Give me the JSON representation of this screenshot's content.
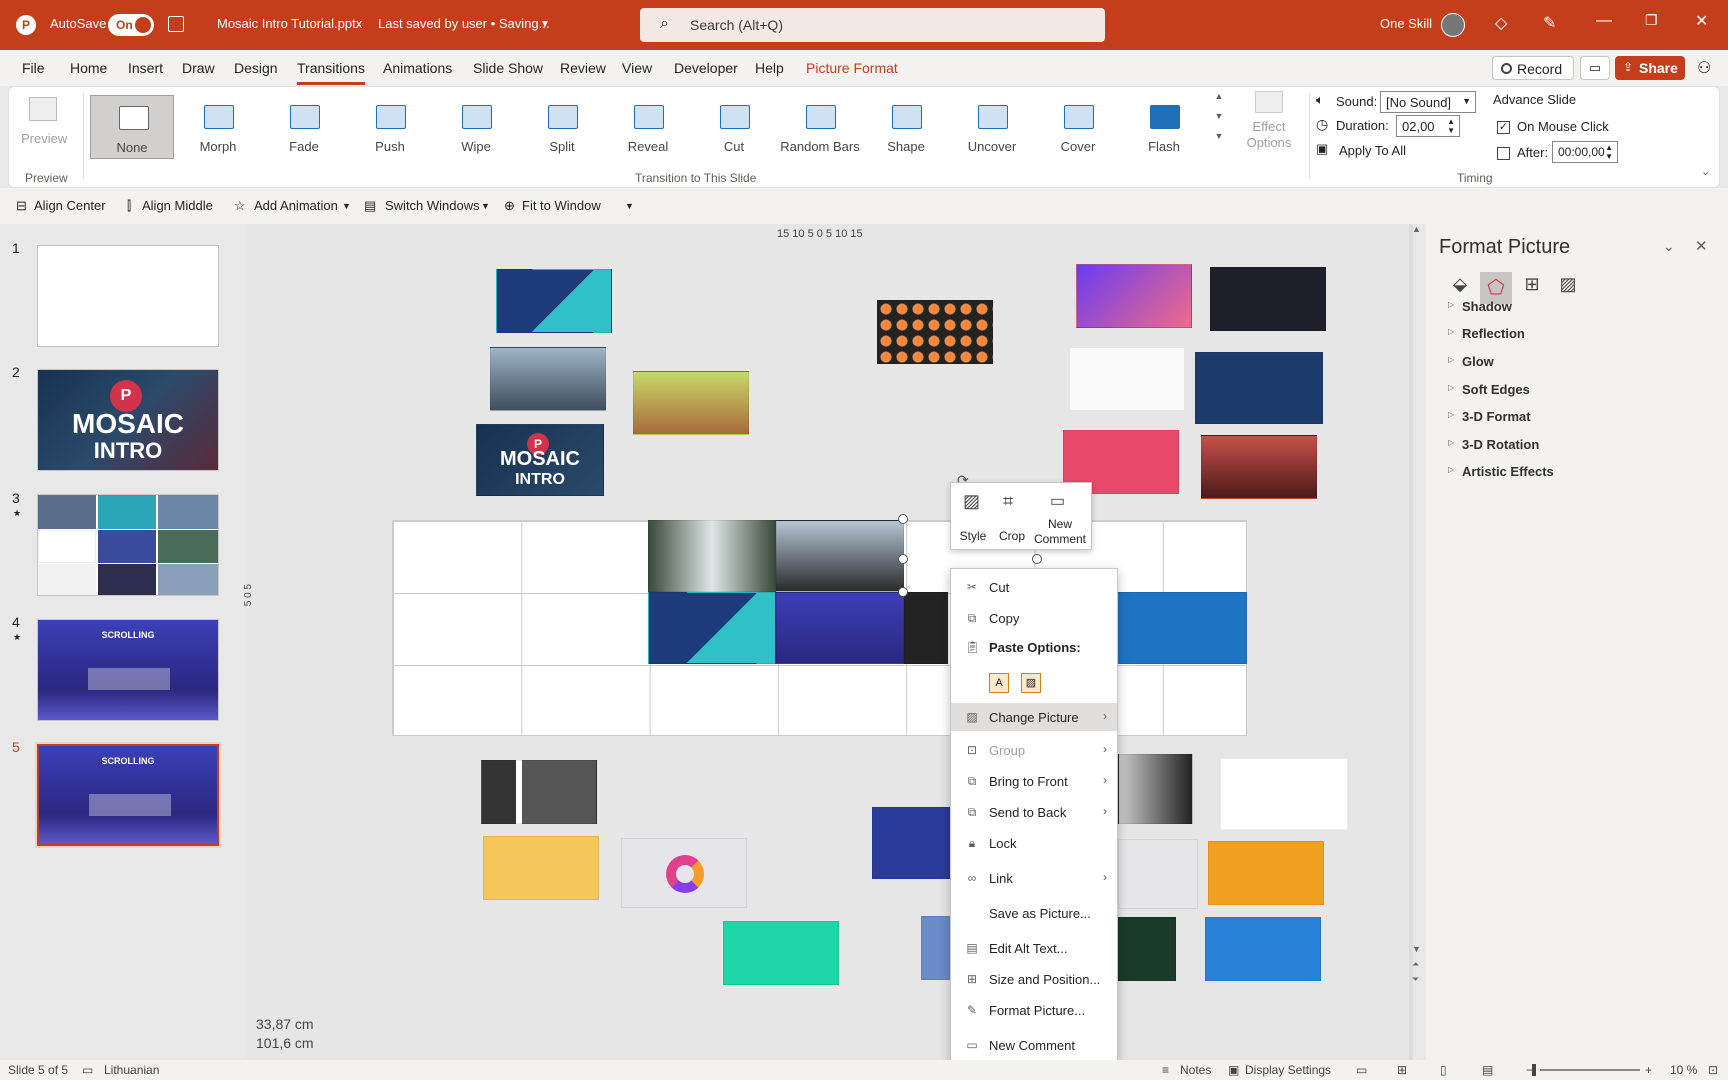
{
  "title_bar": {
    "autosave_label": "AutoSave",
    "toggle_label": "On",
    "doc_title": "Mosaic Intro Tutorial.pptx",
    "save_status": "Last saved by user • Saving...",
    "search_placeholder": "Search (Alt+Q)",
    "user_name": "One Skill",
    "accent_color": "#c43e1c"
  },
  "menu": {
    "tabs": [
      "File",
      "Home",
      "Insert",
      "Draw",
      "Design",
      "Transitions",
      "Animations",
      "Slide Show",
      "Review",
      "View",
      "Developer",
      "Help",
      "Picture Format"
    ],
    "active_tab": "Transitions",
    "record_label": "Record",
    "share_label": "Share"
  },
  "ribbon": {
    "preview_label": "Preview",
    "preview_group": "Preview",
    "transitions": [
      "None",
      "Morph",
      "Fade",
      "Push",
      "Wipe",
      "Split",
      "Reveal",
      "Cut",
      "Random Bars",
      "Shape",
      "Uncover",
      "Cover",
      "Flash"
    ],
    "selected_transition": "None",
    "effect_options_line1": "Effect",
    "effect_options_line2": "Options",
    "transition_group": "Transition to This Slide",
    "sound_label": "Sound:",
    "sound_value": "[No Sound]",
    "duration_label": "Duration:",
    "duration_value": "02,00",
    "apply_all_label": "Apply To All",
    "advance_title": "Advance Slide",
    "on_mouse_click_label": "On Mouse Click",
    "on_mouse_click_checked": true,
    "after_label": "After:",
    "after_value": "00:00,00",
    "timing_group": "Timing"
  },
  "quick_toolbar": {
    "items": [
      "Align Center",
      "Align Middle",
      "Add Animation",
      "Switch Windows",
      "Fit to Window"
    ]
  },
  "ruler": {
    "top": "15 10 5 0 5 10 15",
    "left": "5 0 5"
  },
  "slides": {
    "numbers": [
      "1",
      "2",
      "3",
      "4",
      "5"
    ],
    "current": "5",
    "thumb2_title_1": "MOSAIC",
    "thumb2_title_2": "INTRO",
    "thumb4_title": "SCROLLING",
    "thumb5_title": "SCROLLING"
  },
  "canvas": {
    "mosaic_line1": "MOSAIC",
    "mosaic_line2": "INTRO",
    "position_x": "33,87 cm",
    "position_y": "101,6 cm"
  },
  "format_pane": {
    "title": "Format Picture",
    "sections": [
      "Shadow",
      "Reflection",
      "Glow",
      "Soft Edges",
      "3-D Format",
      "3-D Rotation",
      "Artistic Effects"
    ]
  },
  "mini_toolbar": {
    "style": "Style",
    "crop": "Crop",
    "new_comment_1": "New",
    "new_comment_2": "Comment"
  },
  "context_menu": {
    "cut": "Cut",
    "copy": "Copy",
    "paste_options": "Paste Options:",
    "change_picture": "Change Picture",
    "group": "Group",
    "bring_to_front": "Bring to Front",
    "send_to_back": "Send to Back",
    "lock": "Lock",
    "link": "Link",
    "save_as_picture": "Save as Picture...",
    "edit_alt_text": "Edit Alt Text...",
    "size_and_position": "Size and Position...",
    "format_picture": "Format Picture...",
    "new_comment": "New Comment"
  },
  "status_bar": {
    "slide_info": "Slide 5 of 5",
    "language": "Lithuanian",
    "notes": "Notes",
    "display_settings": "Display Settings",
    "zoom": "10 %"
  }
}
